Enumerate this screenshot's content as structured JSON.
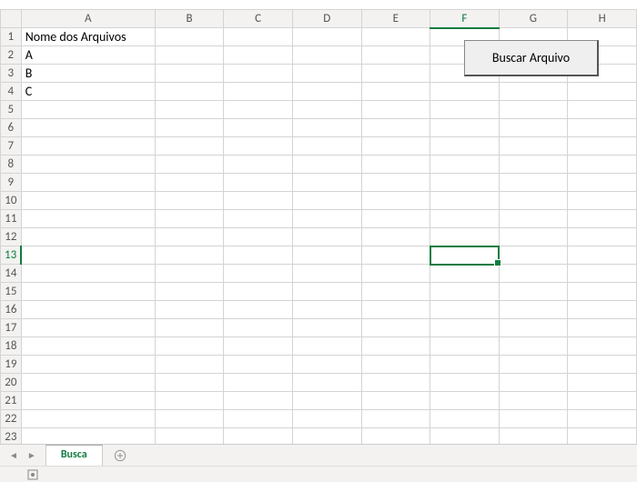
{
  "columns": [
    "A",
    "B",
    "C",
    "D",
    "E",
    "F",
    "G",
    "H"
  ],
  "rows": [
    "1",
    "2",
    "3",
    "4",
    "5",
    "6",
    "7",
    "8",
    "9",
    "10",
    "11",
    "12",
    "13",
    "14",
    "15",
    "16",
    "17",
    "18",
    "19",
    "20",
    "21",
    "22",
    "23"
  ],
  "cells": {
    "A1": "Nome dos Arquivos",
    "A2": "A",
    "A3": "B",
    "A4": "C"
  },
  "activeCell": "F13",
  "button": {
    "label": "Buscar Arquivo"
  },
  "tabs": {
    "active": "Busca"
  }
}
